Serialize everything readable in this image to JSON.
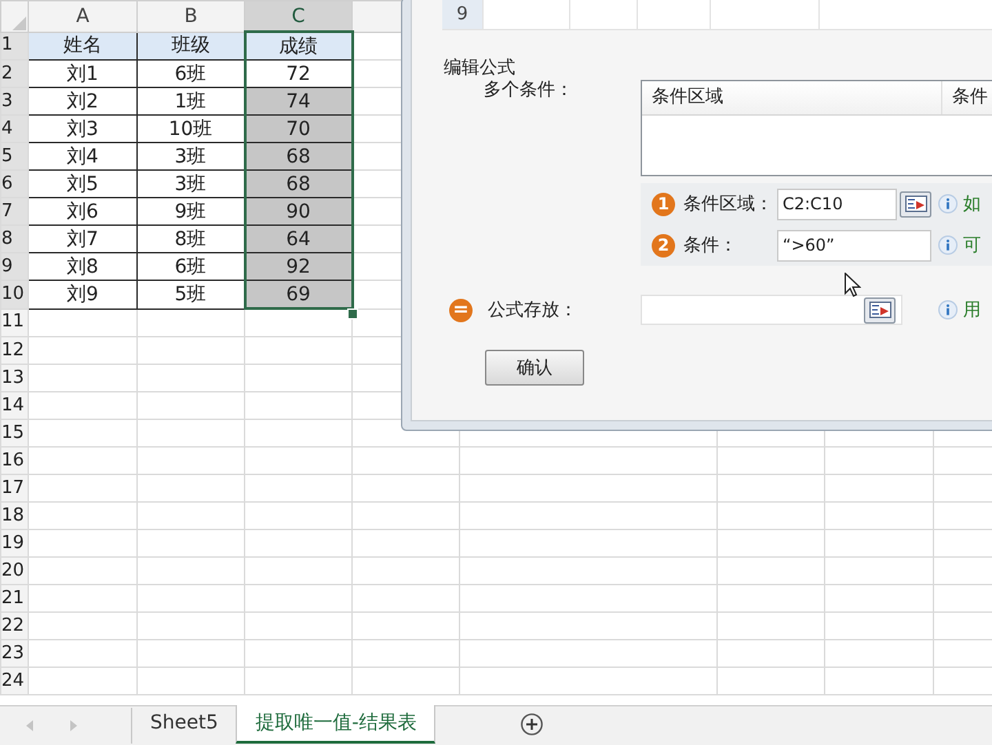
{
  "sheet": {
    "columns": [
      {
        "label": "A",
        "selected": false
      },
      {
        "label": "B",
        "selected": false
      },
      {
        "label": "C",
        "selected": true
      }
    ],
    "row_numbers": [
      {
        "label": "1",
        "selected": true
      },
      {
        "label": "2",
        "selected": true
      },
      {
        "label": "3",
        "selected": true
      },
      {
        "label": "4",
        "selected": true
      },
      {
        "label": "5",
        "selected": true
      },
      {
        "label": "6",
        "selected": true
      },
      {
        "label": "7",
        "selected": true
      },
      {
        "label": "8",
        "selected": true
      },
      {
        "label": "9",
        "selected": true
      },
      {
        "label": "10",
        "selected": true
      },
      {
        "label": "11",
        "selected": false
      },
      {
        "label": "12",
        "selected": false
      },
      {
        "label": "13",
        "selected": false
      },
      {
        "label": "14",
        "selected": false
      },
      {
        "label": "15",
        "selected": false
      },
      {
        "label": "16",
        "selected": false
      },
      {
        "label": "17",
        "selected": false
      },
      {
        "label": "18",
        "selected": false
      },
      {
        "label": "19",
        "selected": false
      },
      {
        "label": "20",
        "selected": false
      },
      {
        "label": "21",
        "selected": false
      },
      {
        "label": "22",
        "selected": false
      },
      {
        "label": "23",
        "selected": false
      },
      {
        "label": "24",
        "selected": false
      }
    ],
    "header": [
      "姓名",
      "班级",
      "成绩"
    ],
    "rows": [
      {
        "name": "刘1",
        "class": "6班",
        "score": "72",
        "selected": false
      },
      {
        "name": "刘2",
        "class": "1班",
        "score": "74",
        "selected": true
      },
      {
        "name": "刘3",
        "class": "10班",
        "score": "70",
        "selected": true
      },
      {
        "name": "刘4",
        "class": "3班",
        "score": "68",
        "selected": true
      },
      {
        "name": "刘5",
        "class": "3班",
        "score": "68",
        "selected": true
      },
      {
        "name": "刘6",
        "class": "9班",
        "score": "90",
        "selected": true
      },
      {
        "name": "刘7",
        "class": "8班",
        "score": "64",
        "selected": true
      },
      {
        "name": "刘8",
        "class": "6班",
        "score": "92",
        "selected": true
      },
      {
        "name": "刘9",
        "class": "5班",
        "score": "69",
        "selected": true
      }
    ]
  },
  "dialog": {
    "preview_row": "9",
    "section_title": "编辑公式",
    "conditions_label": "多个条件：",
    "list_columns": [
      "条件区域",
      "条件"
    ],
    "steps": [
      {
        "badge": "1",
        "label": "条件区域：",
        "value": "C2:C10",
        "picker": true,
        "hint": "如"
      },
      {
        "badge": "2",
        "label": "条件：",
        "value": "“>60”",
        "picker": false,
        "hint": "可"
      }
    ],
    "output": {
      "badge": "=",
      "label": "公式存放：",
      "picker": true,
      "hint": "用"
    },
    "confirm_button": "确认"
  },
  "sheet_tabs": [
    {
      "label": "Sheet5",
      "selected": false
    },
    {
      "label": "提取唯一值-结果表",
      "selected": true
    }
  ]
}
